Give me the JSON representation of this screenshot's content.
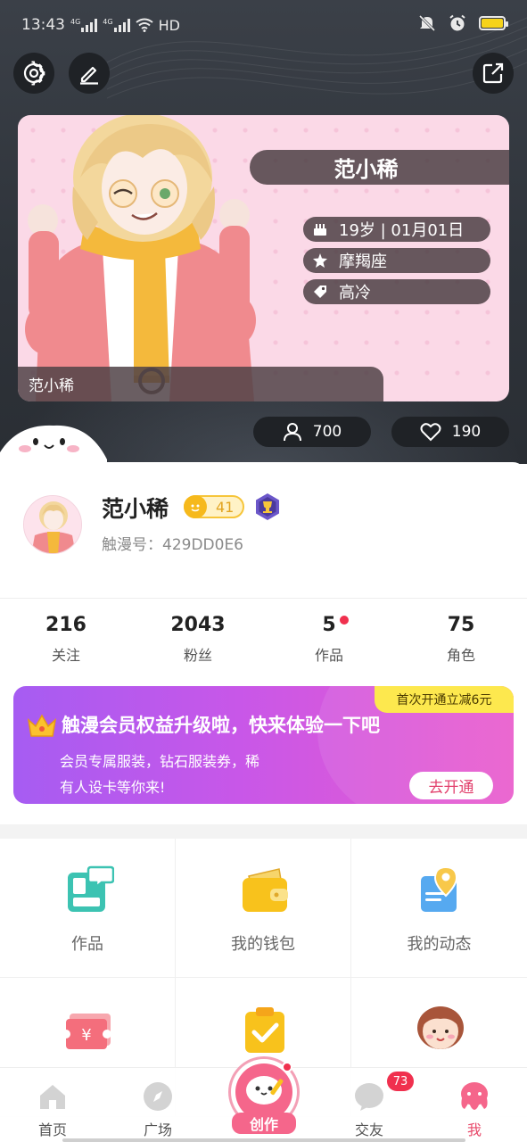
{
  "status_bar": {
    "time": "13:43",
    "network_4g_1": "4G",
    "network_4g_2": "4G",
    "hd": "HD"
  },
  "header": {
    "settings_icon": "gear-icon",
    "edit_icon": "pencil-icon",
    "share_icon": "share-icon"
  },
  "card": {
    "name": "范小稀",
    "age_birthday": "19岁 | 01月01日",
    "constellation": "摩羯座",
    "tag": "高冷",
    "label": "范小稀",
    "visitors": "700",
    "likes": "190"
  },
  "profile": {
    "name": "范小稀",
    "level": "41",
    "id_text": "触漫号：429DD0E6"
  },
  "stats": [
    {
      "value": "216",
      "label": "关注"
    },
    {
      "value": "2043",
      "label": "粉丝"
    },
    {
      "value": "5",
      "label": "作品"
    },
    {
      "value": "75",
      "label": "角色"
    }
  ],
  "vip": {
    "tag": "首次开通立减6元",
    "title": "触漫会员权益升级啦，快来体验一下吧",
    "desc": "会员专属服装，钻石服装券，稀有人设卡等你来!",
    "button": "去开通"
  },
  "grid": [
    {
      "label": "作品",
      "icon": "works-icon"
    },
    {
      "label": "我的钱包",
      "icon": "wallet-icon"
    },
    {
      "label": "我的动态",
      "icon": "location-card-icon"
    },
    {
      "label": "",
      "icon": "ticket-icon"
    },
    {
      "label": "",
      "icon": "clipboard-check-icon"
    },
    {
      "label": "",
      "icon": "girl-face-icon"
    }
  ],
  "tabbar": {
    "home": "首页",
    "square": "广场",
    "create": "创作",
    "friends": "交友",
    "friends_badge": "73",
    "me": "我"
  },
  "colors": {
    "accent": "#e84a6b",
    "vip_start": "#a65cf2",
    "vip_end": "#ea5ccd",
    "header_bg": "#343940"
  }
}
